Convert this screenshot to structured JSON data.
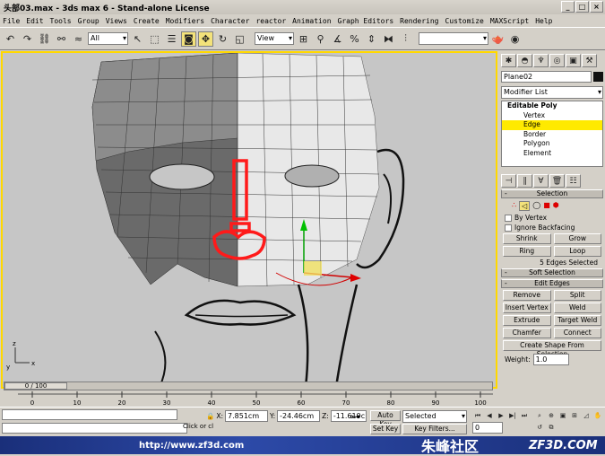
{
  "window": {
    "title": "头部03.max - 3ds max 6 - Stand-alone License"
  },
  "menu": [
    "File",
    "Edit",
    "Tools",
    "Group",
    "Views",
    "Create",
    "Modifiers",
    "Character",
    "reactor",
    "Animation",
    "Graph Editors",
    "Rendering",
    "Customize",
    "MAXScript",
    "Help"
  ],
  "toolbar": {
    "selection_filter": "All",
    "coord_system": "View",
    "icons": [
      "undo-icon",
      "redo-icon",
      "link-icon",
      "unlink-icon",
      "bind-space-warp-icon",
      "select-arrow-icon",
      "select-region-icon",
      "select-by-name-icon",
      "crossing-icon",
      "move-icon",
      "rotate-icon",
      "scale-icon",
      "pivot-icon",
      "snap-toggle-icon",
      "angle-snap-icon",
      "percent-snap-icon",
      "spinner-snap-icon",
      "mirror-icon",
      "align-icon",
      "render-scene-icon",
      "quick-render-icon"
    ]
  },
  "viewport": {
    "label_x": "x",
    "label_y": "y",
    "label_z": "z"
  },
  "command_panel": {
    "object_name": "Plane02",
    "modifier_list": "Modifier List",
    "stack": {
      "root": "Editable Poly",
      "items": [
        "Vertex",
        "Edge",
        "Border",
        "Polygon",
        "Element"
      ],
      "selected": "Edge"
    },
    "selection": {
      "title": "Selection",
      "by_vertex": "By Vertex",
      "ignore_backfacing": "Ignore Backfacing",
      "shrink": "Shrink",
      "grow": "Grow",
      "ring": "Ring",
      "loop": "Loop",
      "status": "5 Edges Selected"
    },
    "soft_selection": "Soft Selection",
    "edit_edges": {
      "title": "Edit Edges",
      "remove": "Remove",
      "split": "Split",
      "insert_vertex": "Insert Vertex",
      "weld": "Weld",
      "extrude": "Extrude",
      "target_weld": "Target Weld",
      "chamfer": "Chamfer",
      "connect": "Connect",
      "create_shape": "Create Shape From Selection",
      "weight_label": "Weight:",
      "weight_value": "1.0"
    }
  },
  "timeline": {
    "slider": "0 / 100",
    "ticks": [
      "0",
      "10",
      "20",
      "30",
      "40",
      "50",
      "60",
      "70",
      "80",
      "90",
      "100"
    ]
  },
  "status": {
    "x_label": "X:",
    "x": "7.851cm",
    "y_label": "Y:",
    "y": "-24.46cm",
    "z_label": "Z:",
    "z": "-11.619c",
    "auto_key": "Auto Key",
    "set_key": "Set Key",
    "key_mode": "Selected",
    "key_filters": "Key Filters...",
    "frame": "0",
    "click_hint": "Click or cl"
  },
  "banner": {
    "url": "http://www.zf3d.com",
    "logo_text": "朱峰社区",
    "brand": "ZF3D.COM"
  }
}
